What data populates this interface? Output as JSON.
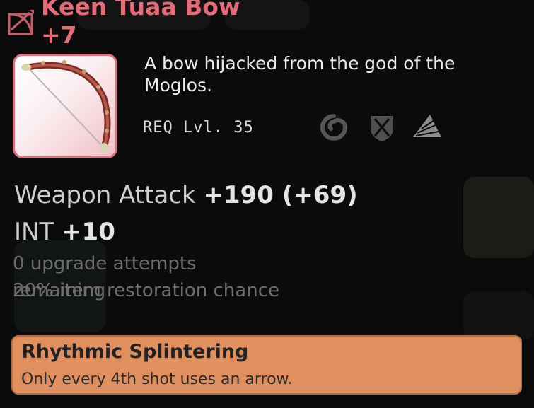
{
  "item": {
    "title_line1": "Keen Tuaa Bow",
    "title_line2": "+7",
    "description": "A bow hijacked from the god of the Moglos.",
    "requirement": "REQ Lvl. 35",
    "icons": [
      "bow-class-icon",
      "wind-icon",
      "shield-icon",
      "sail-icon"
    ]
  },
  "stats": {
    "attack_label": "Weapon Attack",
    "attack_value": "+190 (+69)",
    "int_label": "INT",
    "int_value": "+10"
  },
  "notes": {
    "upgrade_attempts": "0 upgrade attempts",
    "remaining": "remaining",
    "restoration": "20% item restoration chance"
  },
  "ability": {
    "name": "Rhythmic Splintering",
    "description": "Only every 4th shot uses an arrow."
  },
  "colors": {
    "title": "#e76a78",
    "frame": "#e36f7e",
    "ability_bg": "#e0905e"
  }
}
